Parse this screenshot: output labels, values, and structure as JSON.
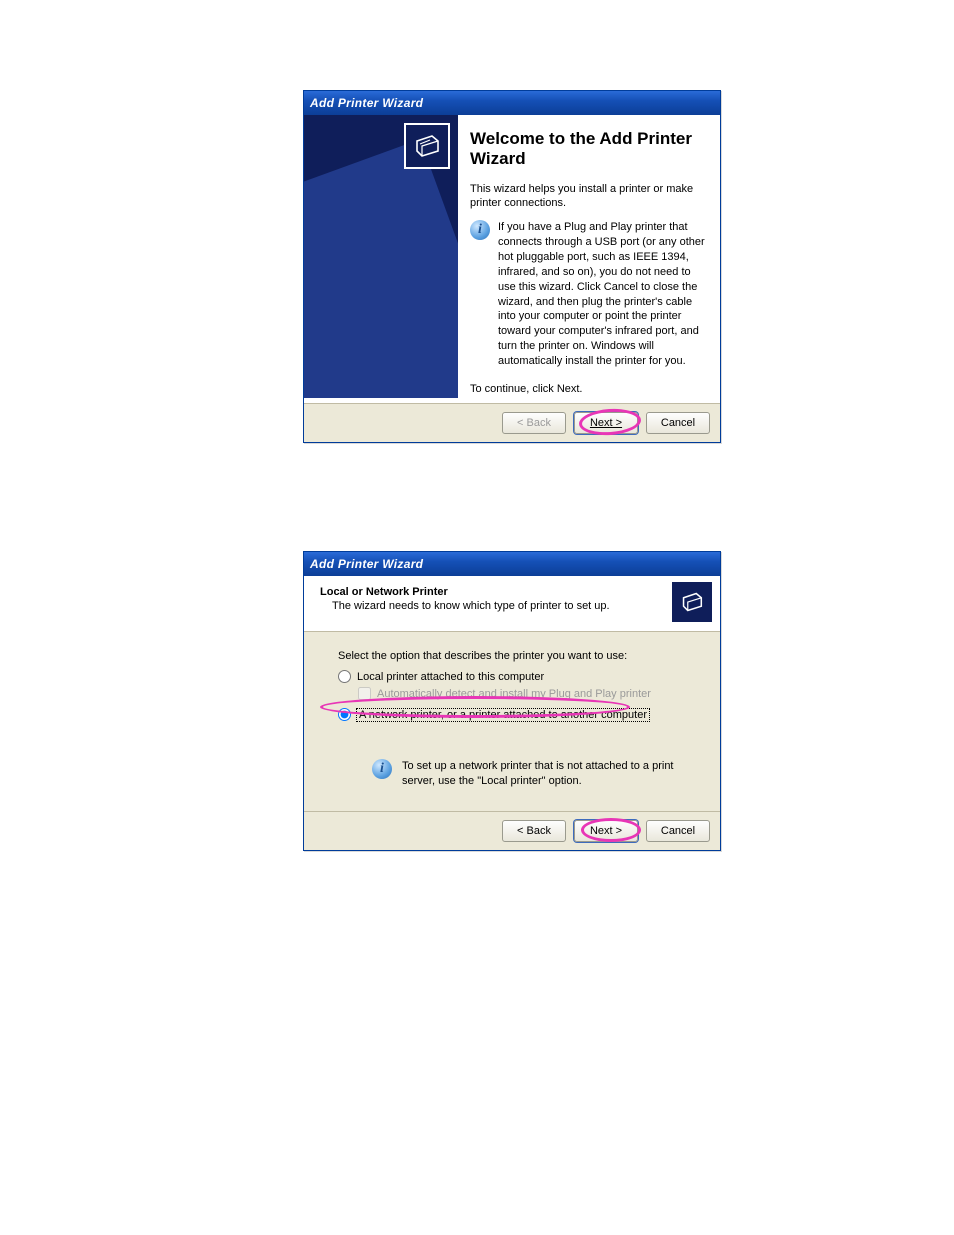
{
  "dialog1": {
    "title": "Add Printer Wizard",
    "heading": "Welcome to the Add Printer Wizard",
    "intro": "This wizard helps you install a printer or make printer connections.",
    "note": "If you have a Plug and Play printer that connects through a USB port (or any other hot pluggable port, such as IEEE 1394, infrared, and so on), you do not need to use this wizard. Click Cancel to close the wizard, and then plug the printer's cable into your computer or point the printer toward your computer's infrared port, and turn the printer on. Windows will automatically install the printer for you.",
    "continue_text": "To continue, click Next.",
    "buttons": {
      "back": "< Back",
      "next": "Next >",
      "cancel": "Cancel"
    }
  },
  "dialog2": {
    "title": "Add Printer Wizard",
    "header_title": "Local or Network Printer",
    "header_sub": "The wizard needs to know which type of printer to set up.",
    "prompt": "Select the option that describes the printer you want to use:",
    "opt_local": "Local printer attached to this computer",
    "chk_auto": "Automatically detect and install my Plug and Play printer",
    "opt_network": "A network printer, or a printer attached to another computer",
    "selected": "network",
    "note": "To set up a network printer that is not attached to a print server, use the \"Local printer\" option.",
    "buttons": {
      "back": "< Back",
      "next": "Next >",
      "cancel": "Cancel"
    }
  },
  "icons": {
    "info": "i"
  }
}
